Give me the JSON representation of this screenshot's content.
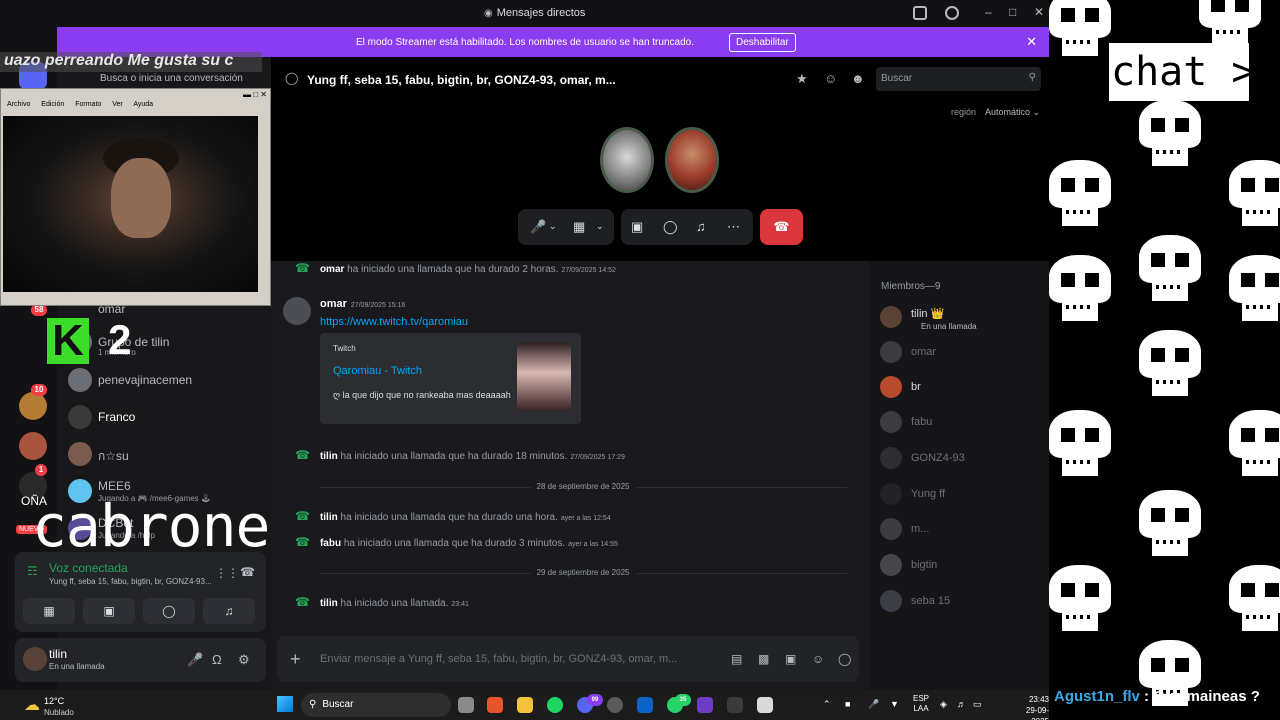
{
  "window": {
    "title": "Mensajes directos"
  },
  "banner": {
    "message": "El modo Streamer está habilitado. Los nombres de usuario se han truncado.",
    "button": "Deshabilitar"
  },
  "overlay": {
    "top_text": "uazo perreando  Me gusta su c",
    "k_label": "K",
    "two_label": "2",
    "big_text": "cabrones",
    "chat_label": "chat >:(",
    "viewer_name": "Agust1n_flv",
    "viewer_sep": " : ",
    "viewer_msg": "Que maineas ?"
  },
  "webcam": {
    "menu": [
      "Archivo",
      "Edición",
      "Formato",
      "Ver",
      "Ayuda"
    ]
  },
  "rail": {
    "badges": [
      "58",
      "10",
      "1"
    ],
    "label": "OÑA",
    "new_label": "NUEVO"
  },
  "dm_sidebar": {
    "search_placeholder": "Busca o inicia una conversación",
    "items": [
      {
        "name": "omar",
        "sub": ""
      },
      {
        "name": "Grupo de tilin",
        "sub": "1 miembro"
      },
      {
        "name": "penevajinacemen",
        "sub": ""
      },
      {
        "name": "Franco",
        "sub": ""
      },
      {
        "name": "ก☆su",
        "sub": ""
      },
      {
        "name": "MEE6",
        "sub": "Jugando a 🎮 /mee6-games 🕹"
      },
      {
        "name": "DCBot",
        "sub": "Jugando a /help"
      }
    ]
  },
  "voice": {
    "status": "Voz conectada",
    "channel": "Yung ff, seba 15, fabu, bigtin, br, GONZ4-93...",
    "signal_icon": "signal-icon",
    "wave_icon": "waveform-icon",
    "disconnect_icon": "phone-hangup-icon"
  },
  "user": {
    "name": "tilin",
    "status": "En una llamada"
  },
  "header": {
    "title": "Yung ff, seba 15, fabu, bigtin, br, GONZ4-93, omar, m...",
    "search_placeholder": "Buscar"
  },
  "call": {
    "region_label": "región",
    "region_value": "Automático ⌄"
  },
  "chat": {
    "top_line": {
      "user": "omar",
      "text": " ha iniciado una llamada que ha durado 2 horas.",
      "time": "27/09/2025 14:52"
    },
    "message": {
      "user": "omar",
      "time": "27/09/2025 15:16",
      "link": "https://www.twitch.tv/qaromiau",
      "embed": {
        "provider": "Twitch",
        "title": "Qaromiau - Twitch",
        "description": "ღ la que dijo que no rankeaba mas deaaaah"
      }
    },
    "line2": {
      "user": "tilin",
      "text": " ha iniciado una llamada que ha durado 18 minutos.",
      "time": "27/09/2025 17:29"
    },
    "divider1": "28 de septiembre de 2025",
    "line3": {
      "user": "tilin",
      "text": " ha iniciado una llamada que ha durado una hora.",
      "time": "ayer a las 12:54"
    },
    "line4": {
      "user": "fabu",
      "text": " ha iniciado una llamada que ha durado 3 minutos.",
      "time": "ayer a las 14:55"
    },
    "divider2": "29 de septiembre de 2025",
    "line5": {
      "user": "tilin",
      "text": " ha iniciado una llamada.",
      "time": "23:41"
    }
  },
  "composer": {
    "placeholder": "Enviar mensaje a Yung ff, seba 15, fabu, bigtin, br, GONZ4-93, omar, m..."
  },
  "members": {
    "header": "Miembros—9",
    "list": [
      {
        "name": "tilin 👑",
        "sub": "En una llamada"
      },
      {
        "name": "omar",
        "sub": ""
      },
      {
        "name": "br",
        "sub": ""
      },
      {
        "name": "fabu",
        "sub": ""
      },
      {
        "name": "GONZ4-93",
        "sub": ""
      },
      {
        "name": "Yung ff",
        "sub": ""
      },
      {
        "name": "m...",
        "sub": ""
      },
      {
        "name": "bigtin",
        "sub": ""
      },
      {
        "name": "seba 15",
        "sub": ""
      }
    ]
  },
  "taskbar": {
    "temp": "12°C",
    "condition": "Nublado",
    "search": "Buscar",
    "lang_top": "ESP",
    "lang_bottom": "LAA",
    "time": "23:43",
    "date": "29-09-2025",
    "app_badges": [
      "99",
      "35"
    ]
  },
  "colors": {
    "banner": "#8a3cf0",
    "hangup": "#da373c",
    "link": "#00a8fc",
    "online": "#23a55a",
    "viewer": "#3aa8e0"
  }
}
